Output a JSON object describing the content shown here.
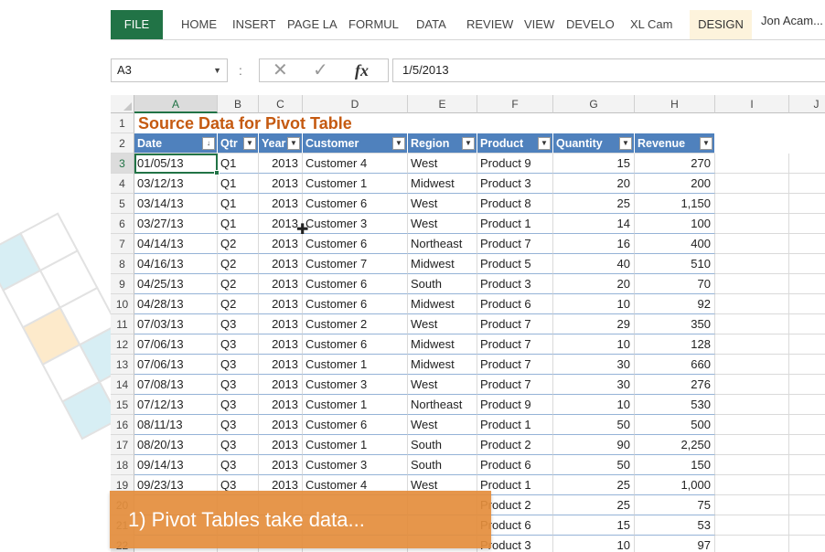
{
  "ribbon": {
    "tabs": [
      "FILE",
      "HOME",
      "INSERT",
      "PAGE LA",
      "FORMUL",
      "DATA",
      "REVIEW",
      "VIEW",
      "DEVELO",
      "XL Cam",
      "DESIGN"
    ],
    "user": "Jon Acam..."
  },
  "formula_bar": {
    "name_box": "A3",
    "separator": ":",
    "cancel_icon": "✕",
    "enter_icon": "✓",
    "fx_label": "fx",
    "value": "1/5/2013"
  },
  "columns": [
    "A",
    "B",
    "C",
    "D",
    "E",
    "F",
    "G",
    "H",
    "I",
    "J"
  ],
  "sheet": {
    "title": "Source Data for Pivot Table",
    "headers": [
      "Date",
      "Qtr",
      "Year",
      "Customer",
      "Region",
      "Product",
      "Quantity",
      "Revenue"
    ],
    "sort_icon": "↓",
    "dropdown_icon": "▼",
    "rows": [
      {
        "r": "3",
        "c": [
          "01/05/13",
          "Q1",
          "2013",
          "Customer 4",
          "West",
          "Product 9",
          "15",
          "270"
        ]
      },
      {
        "r": "4",
        "c": [
          "03/12/13",
          "Q1",
          "2013",
          "Customer 1",
          "Midwest",
          "Product 3",
          "20",
          "200"
        ]
      },
      {
        "r": "5",
        "c": [
          "03/14/13",
          "Q1",
          "2013",
          "Customer 6",
          "West",
          "Product 8",
          "25",
          "1,150"
        ]
      },
      {
        "r": "6",
        "c": [
          "03/27/13",
          "Q1",
          "2013",
          "Customer 3",
          "West",
          "Product 1",
          "14",
          "100"
        ]
      },
      {
        "r": "7",
        "c": [
          "04/14/13",
          "Q2",
          "2013",
          "Customer 6",
          "Northeast",
          "Product 7",
          "16",
          "400"
        ]
      },
      {
        "r": "8",
        "c": [
          "04/16/13",
          "Q2",
          "2013",
          "Customer 7",
          "Midwest",
          "Product 5",
          "40",
          "510"
        ]
      },
      {
        "r": "9",
        "c": [
          "04/25/13",
          "Q2",
          "2013",
          "Customer 6",
          "South",
          "Product 3",
          "20",
          "70"
        ]
      },
      {
        "r": "10",
        "c": [
          "04/28/13",
          "Q2",
          "2013",
          "Customer 6",
          "Midwest",
          "Product 6",
          "10",
          "92"
        ]
      },
      {
        "r": "11",
        "c": [
          "07/03/13",
          "Q3",
          "2013",
          "Customer 2",
          "West",
          "Product 7",
          "29",
          "350"
        ]
      },
      {
        "r": "12",
        "c": [
          "07/06/13",
          "Q3",
          "2013",
          "Customer 6",
          "Midwest",
          "Product 7",
          "10",
          "128"
        ]
      },
      {
        "r": "13",
        "c": [
          "07/06/13",
          "Q3",
          "2013",
          "Customer 1",
          "Midwest",
          "Product 7",
          "30",
          "660"
        ]
      },
      {
        "r": "14",
        "c": [
          "07/08/13",
          "Q3",
          "2013",
          "Customer 3",
          "West",
          "Product 7",
          "30",
          "276"
        ]
      },
      {
        "r": "15",
        "c": [
          "07/12/13",
          "Q3",
          "2013",
          "Customer 1",
          "Northeast",
          "Product 9",
          "10",
          "530"
        ]
      },
      {
        "r": "16",
        "c": [
          "08/11/13",
          "Q3",
          "2013",
          "Customer 6",
          "West",
          "Product 1",
          "50",
          "500"
        ]
      },
      {
        "r": "17",
        "c": [
          "08/20/13",
          "Q3",
          "2013",
          "Customer 1",
          "South",
          "Product 2",
          "90",
          "2,250"
        ]
      },
      {
        "r": "18",
        "c": [
          "09/14/13",
          "Q3",
          "2013",
          "Customer 3",
          "South",
          "Product 6",
          "50",
          "150"
        ]
      },
      {
        "r": "19",
        "c": [
          "09/23/13",
          "Q3",
          "2013",
          "Customer 4",
          "West",
          "Product 1",
          "25",
          "1,000"
        ]
      },
      {
        "r": "20",
        "c": [
          "",
          "",
          "",
          "",
          "",
          "Product 2",
          "25",
          "75"
        ]
      },
      {
        "r": "21",
        "c": [
          "",
          "",
          "",
          "",
          "",
          "Product 6",
          "15",
          "53"
        ]
      },
      {
        "r": "22",
        "c": [
          "",
          "",
          "",
          "",
          "",
          "Product 3",
          "10",
          "97"
        ]
      }
    ]
  },
  "caption": "1) Pivot Tables take data...",
  "colors": {
    "excel_green": "#217346",
    "header_blue": "#4f81bd",
    "title_orange": "#c55a11",
    "caption_orange": "#e48e3c"
  }
}
